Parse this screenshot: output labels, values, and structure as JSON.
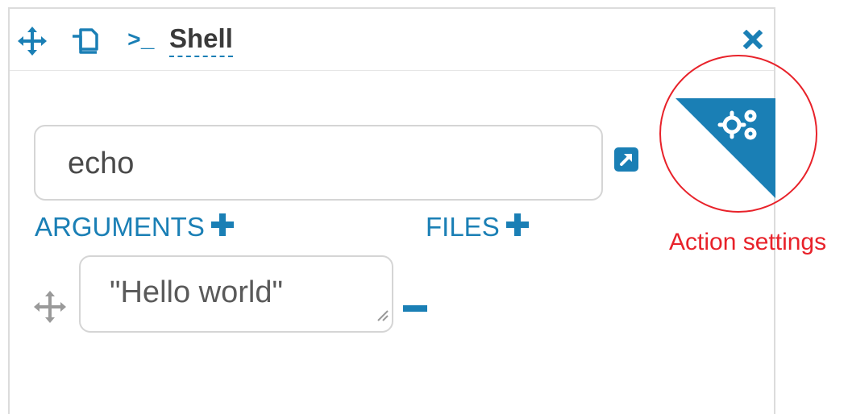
{
  "header": {
    "move_icon": "move-icon",
    "copy_icon": "copy-icon",
    "prompt_glyph": ">_",
    "title": "Shell",
    "close_icon": "close-icon"
  },
  "command": {
    "value": "echo",
    "expand_icon": "external-link-icon"
  },
  "arguments": {
    "label": "ARGUMENTS",
    "items": [
      {
        "value": "\"Hello world\""
      }
    ]
  },
  "files": {
    "label": "FILES"
  },
  "action_settings": {
    "icon": "gears-icon",
    "callout": "Action settings"
  },
  "colors": {
    "accent": "#1a7fb5",
    "annotation": "#e8222a",
    "text": "#3a3a3a",
    "border": "#d5d5d5"
  }
}
